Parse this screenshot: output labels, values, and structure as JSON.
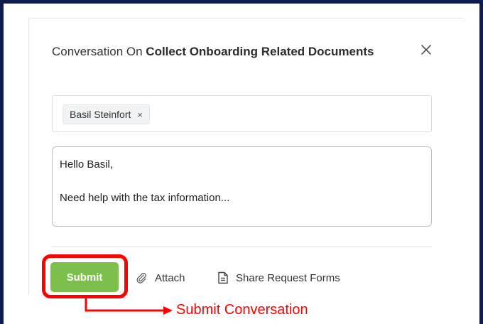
{
  "dialog": {
    "title_prefix": "Conversation On ",
    "title_subject": "Collect Onboarding Related Documents",
    "close_icon": "close-icon"
  },
  "recipients": {
    "chips": [
      {
        "name": "Basil Steinfort",
        "remove_label": "×"
      }
    ]
  },
  "message": {
    "line1": "Hello Basil,",
    "line2": "Need help with the tax information..."
  },
  "actions": {
    "submit_label": "Submit",
    "attach_label": "Attach",
    "attach_icon": "paperclip-icon",
    "share_label": "Share Request Forms",
    "share_icon": "document-icon"
  },
  "annotation": {
    "label": "Submit Conversation",
    "color": "#ff0000"
  },
  "colors": {
    "frame": "#0d1b4f",
    "submit_button": "#7cc04b",
    "highlight": "#ff0000"
  }
}
